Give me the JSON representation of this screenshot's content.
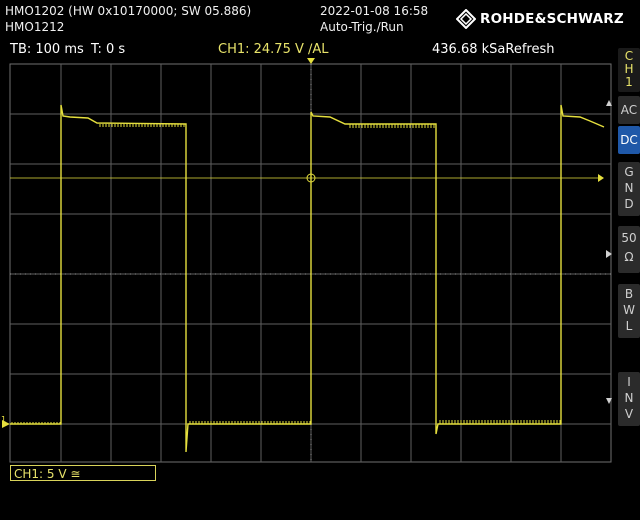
{
  "header": {
    "device_line1": "HMO1202 (HW 0x10170000; SW 05.886)",
    "device_line2": "HMO1212",
    "datetime": "2022-01-08 16:58",
    "trigger_mode": "Auto-Trig./Run",
    "brand": "ROHDE&SCHWARZ",
    "brand_icon": "rs-diamond-logo"
  },
  "status": {
    "timebase": "TB: 100 ms",
    "trigger_time": "T: 0 s",
    "trigger_level": "CH1: 24.75 V ∕AL",
    "sample_rate": "436.68 kSaRefresh"
  },
  "side_menu": {
    "channel": [
      "C",
      "H",
      "1"
    ],
    "ac": "AC",
    "dc": "DC",
    "gnd": [
      "G",
      "N",
      "D"
    ],
    "ohm": [
      "50",
      "Ω"
    ],
    "bwl": [
      "B",
      "W",
      "L"
    ],
    "inv": [
      "I",
      "N",
      "V"
    ]
  },
  "channel_label": "CH1: 5 V ≅",
  "ground_marker": "1",
  "colors": {
    "trace": "#e5df3e",
    "grid": "#5f5f5f",
    "active_button": "#1f58a8"
  }
}
